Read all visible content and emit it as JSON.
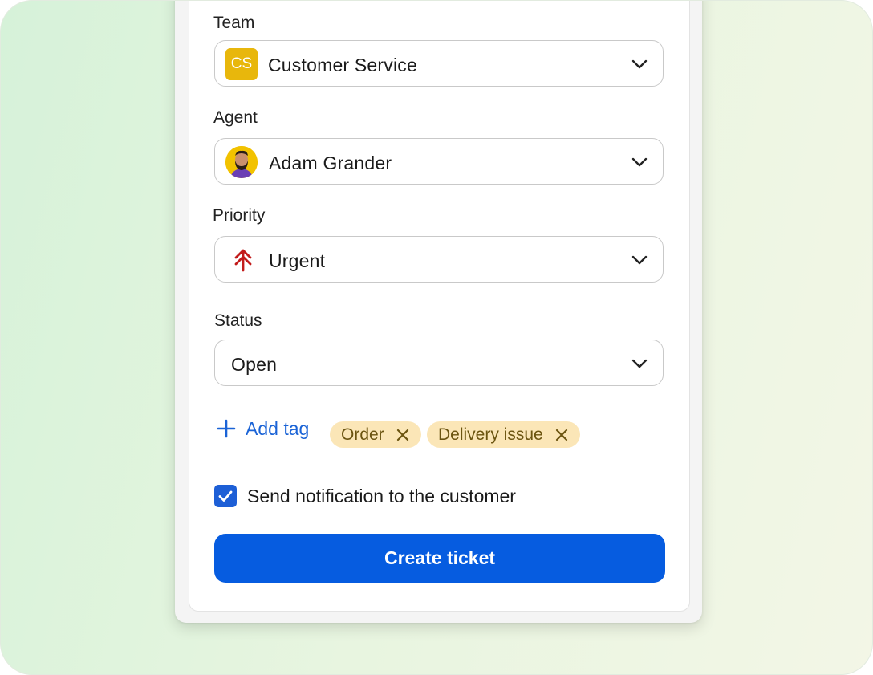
{
  "form": {
    "team": {
      "label": "Team",
      "value": "Customer Service",
      "badge": "CS",
      "badge_color": "#e8b70c"
    },
    "agent": {
      "label": "Agent",
      "value": "Adam Grander",
      "avatar_color": "#f2c200"
    },
    "priority": {
      "label": "Priority",
      "value": "Urgent",
      "icon": "urgent-arrows-icon",
      "icon_color": "#c21b1b"
    },
    "status": {
      "label": "Status",
      "value": "Open"
    },
    "tags": {
      "add_label": "Add tag",
      "items": [
        {
          "label": "Order"
        },
        {
          "label": "Delivery issue"
        }
      ],
      "tag_bg": "#fbe6b7"
    },
    "notify": {
      "label": "Send notification to the customer",
      "checked": true
    },
    "submit_label": "Create ticket",
    "accent": "#065ce0"
  }
}
